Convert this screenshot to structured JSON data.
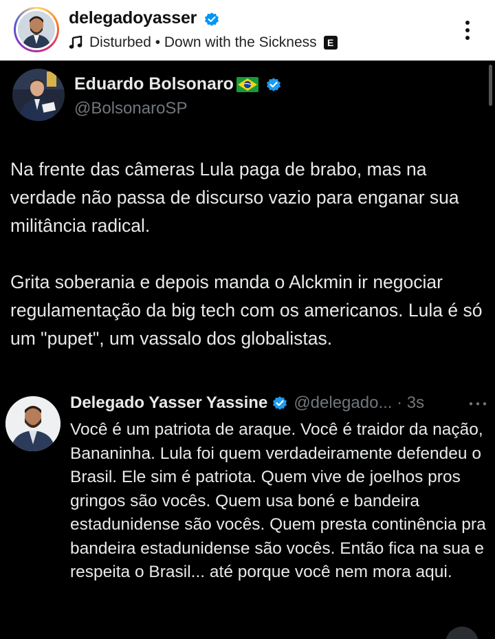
{
  "ig_post": {
    "username": "delegadoyasser",
    "music": "Disturbed • Down with the Sickness",
    "explicit_badge": "E",
    "icons": [
      "verified-badge-icon",
      "music-note-icon",
      "explicit-icon",
      "more-vertical-icon"
    ]
  },
  "tweet": {
    "author_name": "Eduardo Bolsonaro",
    "author_handle": "@BolsonaroSP",
    "paragraph_1": "Na frente das câmeras Lula paga de brabo, mas na verdade não passa de discurso vazio para enganar sua militância radical.",
    "paragraph_2": "Grita soberania e depois manda o Alckmin ir negociar regulamentação da big tech com os americanos. Lula é só um \"pupet\", um vassalo dos globalistas."
  },
  "reply": {
    "author_name": "Delegado Yasser Yassine",
    "handle_time": "@delegado... · 3s",
    "text": "Você é um patriota de araque. Você é traidor da nação, Bananinha. Lula foi quem verdadeiramente defendeu o Brasil. Ele sim é patriota. Quem vive de joelhos pros gringos são vocês. Quem usa boné e bandeira estadunidense são vocês. Quem presta continência pra bandeira estadunidense são vocês. Então fica na sua e respeita o Brasil... até porque você nem mora aqui."
  },
  "colors": {
    "background": "#000000",
    "text_primary": "#e7e9ea",
    "text_secondary": "#71767b",
    "verified_blue": "#1d9bf0",
    "ig_verified_blue": "#0095f6"
  }
}
